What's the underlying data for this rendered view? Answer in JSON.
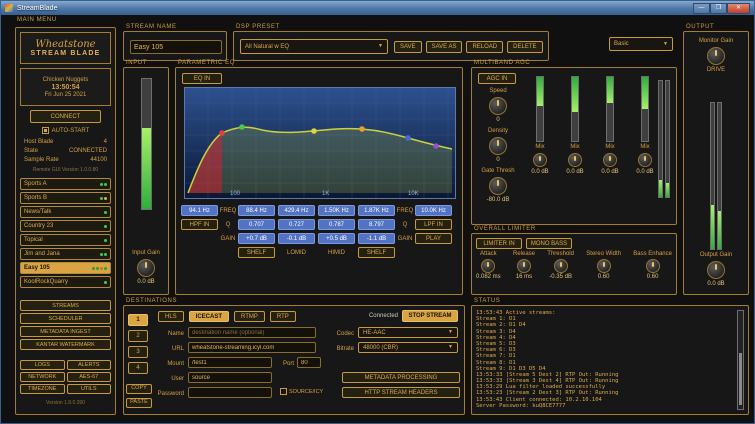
{
  "window": {
    "title": "StreamBlade",
    "minimize_glyph": "—",
    "maximize_glyph": "❐",
    "close_glyph": "✕"
  },
  "sidebar": {
    "menu_title": "MAIN MENU",
    "brand": "Wheatstone",
    "product": "STREAM BLADE",
    "device_name": "Chicken Nuggets",
    "clock": "13:50:54",
    "date": "Fri Jun 25 2021",
    "connect_label": "CONNECT",
    "autostart_label": "AUTO-START",
    "info_rows": [
      {
        "label": "Host Blade",
        "value": "4"
      },
      {
        "label": "State",
        "value": "CONNECTED"
      },
      {
        "label": "Sample Rate",
        "value": "44100"
      }
    ],
    "gui_version": "Remote GUI Version 1.0.0.80",
    "streams": [
      {
        "label": "Sports A",
        "active": false,
        "dots": [
          "#3ecc4e",
          "#3ecc4e"
        ]
      },
      {
        "label": "Sports B",
        "active": false,
        "dots": [
          "#3ecc4e",
          "#e0b050"
        ]
      },
      {
        "label": "News/Talk",
        "active": false,
        "dots": [
          "#3ecc4e"
        ]
      },
      {
        "label": "Country 23",
        "active": false,
        "dots": [
          "#3ecc4e"
        ]
      },
      {
        "label": "Topical",
        "active": false,
        "dots": [
          "#3ecc4e"
        ]
      },
      {
        "label": "Jim and Jana",
        "active": false,
        "dots": [
          "#3ecc4e",
          "#3ecc4e"
        ]
      },
      {
        "label": "Easy 105",
        "active": true,
        "dots": [
          "#2f9e3f",
          "#2f9e3f",
          "#b5822a",
          "#2f9e3f"
        ]
      },
      {
        "label": "KoolRockQuarry",
        "active": false,
        "dots": [
          "#3ecc4e"
        ]
      }
    ],
    "nav_buttons": [
      "STREAMS",
      "SCHEDULER",
      "METADATA INGEST",
      "KANTAR WATERMARK"
    ],
    "grid_buttons": [
      "LOGS",
      "ALERTS",
      "NETWORK",
      "AES-67",
      "TIMEZONE",
      "UTILS"
    ],
    "footer_version": "Version 1.8.0.390"
  },
  "stream_name": {
    "title": "STREAM NAME",
    "value": "Easy 105"
  },
  "dsp_preset": {
    "title": "DSP PRESET",
    "selected": "All Natural w EQ",
    "buttons": [
      "SAVE",
      "SAVE AS",
      "RELOAD",
      "DELETE"
    ],
    "mode_selected": "Basic"
  },
  "input_section": {
    "title": "INPUT",
    "gain_label": "Input Gain",
    "gain_value": "0.0 dB"
  },
  "eq": {
    "title": "PARAMETRIC EQ",
    "eq_in_label": "EQ IN",
    "freq_label": "FREQ",
    "q_label": "Q",
    "gain_label": "GAIN",
    "play_label": "PLAY",
    "hpf": {
      "freq": "94.1 Hz",
      "in_label": "HPF IN"
    },
    "lpf": {
      "freq": "10.0K Hz",
      "in_label": "LPF IN"
    },
    "bands": [
      {
        "freq": "88.4 Hz",
        "q": "0.707",
        "gain": "+0.7 dB",
        "foot": "SHELF",
        "shelf": true
      },
      {
        "freq": "429.4 Hz",
        "q": "0.727",
        "gain": "-0.1 dB",
        "foot": "LOMID",
        "shelf": false
      },
      {
        "freq": "1.50K Hz",
        "q": "0.787",
        "gain": "+0.5 dB",
        "foot": "HIMID",
        "shelf": false
      },
      {
        "freq": "1.87K Hz",
        "q": "8.797",
        "gain": "-1.1 dB",
        "foot": "SHELF",
        "shelf": true
      }
    ],
    "axis_x": [
      "100",
      "1K",
      "10K"
    ],
    "dot_colors": [
      "#e04040",
      "#48c848",
      "#d8d840",
      "#e8a030",
      "#4868d8",
      "#9850c8"
    ]
  },
  "agc": {
    "title": "MULTIBAND AGC",
    "agc_in_label": "AGC IN",
    "knobs": [
      {
        "label": "Speed",
        "value": "0"
      },
      {
        "label": "Density",
        "value": "0"
      },
      {
        "label": "Gate Thresh",
        "value": "-80.0 dB"
      }
    ],
    "bands": [
      {
        "mix_label": "Mix",
        "value": "0.0 dB",
        "meter": 0.45
      },
      {
        "mix_label": "Mix",
        "value": "0.0 dB",
        "meter": 0.55
      },
      {
        "mix_label": "Mix",
        "value": "0.0 dB",
        "meter": 0.4
      },
      {
        "mix_label": "Mix",
        "value": "0.0 dB",
        "meter": 0.5
      }
    ]
  },
  "limiter": {
    "title": "OVERALL LIMITER",
    "limiter_in_label": "LIMITER IN",
    "mono_bass_label": "MONO BASS",
    "knobs": [
      {
        "label": "Attack",
        "value": "0.082 ms"
      },
      {
        "label": "Release",
        "value": "16 ms"
      },
      {
        "label": "Threshold",
        "value": "-0.35 dB"
      },
      {
        "label": "Stereo Width",
        "value": "0.60"
      },
      {
        "label": "Bass Enhance",
        "value": "0.60"
      }
    ]
  },
  "output_section": {
    "title": "OUTPUT",
    "monitor_gain_label": "Monitor Gain",
    "drive_label": "DRIVE",
    "output_gain_label": "Output Gain",
    "output_gain_value": "0.0 dB"
  },
  "destinations": {
    "title": "DESTINATIONS",
    "slots": [
      "1",
      "2",
      "3",
      "4"
    ],
    "active_slot": 0,
    "tabs": [
      "HLS",
      "ICECAST",
      "RTMP",
      "RTP"
    ],
    "active_tab": 1,
    "status": "Connected",
    "stop_label": "STOP STREAM",
    "copy_label": "COPY",
    "paste_label": "PASTE",
    "fields": {
      "name_label": "Name",
      "name_placeholder": "destination name (optional)",
      "url_label": "URL",
      "url_value": "wheatstone-streaming.icyl.com",
      "mount_label": "Mount",
      "mount_value": "/test1",
      "port_label": "Port",
      "port_value": "80",
      "user_label": "User",
      "user_value": "source",
      "password_label": "Password",
      "password_value": "",
      "codec_label": "Codec",
      "codec_value": "HE-AAC",
      "bitrate_label": "Bitrate",
      "bitrate_value": "48000 (CBR)",
      "source_icy_label": "SOURCE/ICY"
    },
    "metadata_button": "METADATA PROCESSING",
    "headers_button": "HTTP STREAM HEADERS"
  },
  "status_panel": {
    "title": "STATUS",
    "lines": [
      "13:53:43  Active streams:",
      "Stream 1: D1",
      "Stream 2: D1 D4",
      "Stream 3: D4",
      "Stream 4: D4",
      "Stream 5: D3",
      "Stream 6: D3",
      "Stream 7: D1",
      "Stream 8: D1",
      "Stream 9: D1 D3 D5 D4",
      "13:53:33  [Stream 5 Dest 2] RTP Out: Running",
      "13:53:33  [Stream 3 Dest 4] RTP Out: Running",
      "13:53:29  Lua filter loaded successfully",
      "13:53:23  [Stream 2 Dest 3] RTP Out: Running",
      "13:53:43  Client connected: 10.2.10.104",
      "Server Password: kuQ8CE7777"
    ]
  },
  "meters": {
    "input": 0.62,
    "agc_out": [
      0.15,
      0.12
    ],
    "output": [
      0.3,
      0.26
    ]
  },
  "colors": {
    "accent": "#d9a441",
    "value_blue": "#5272c4",
    "meter_green": "#3ecc4e"
  }
}
